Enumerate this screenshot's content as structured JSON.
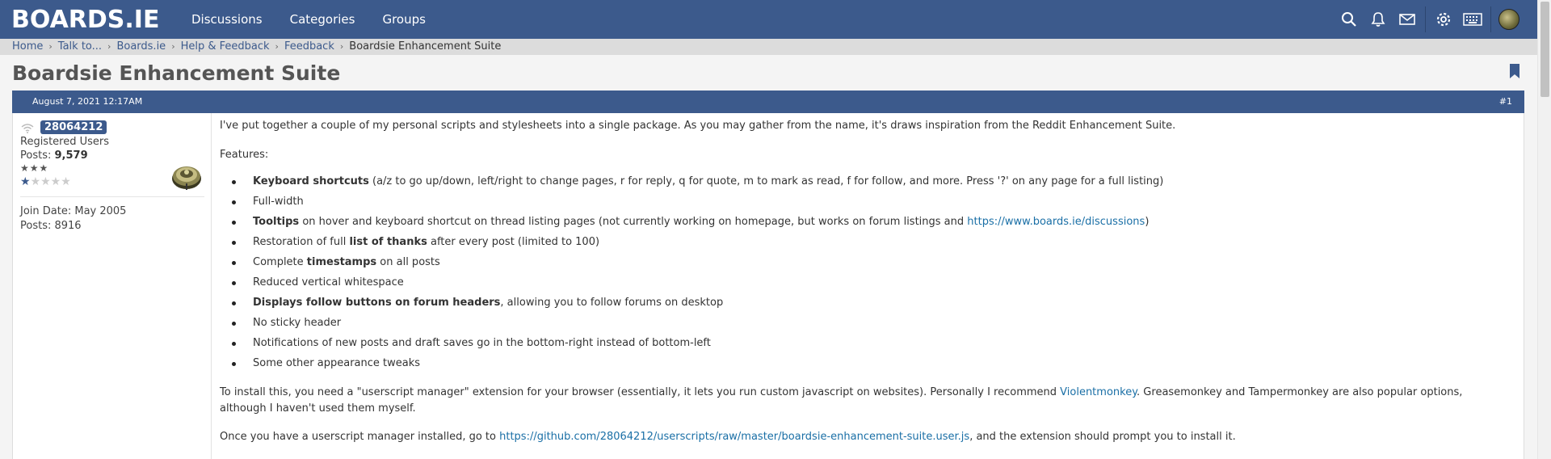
{
  "brand": {
    "logo_text": "BOARDS.IE"
  },
  "nav": {
    "links": [
      "Discussions",
      "Categories",
      "Groups"
    ]
  },
  "breadcrumb": [
    "Home",
    "Talk to...",
    "Boards.ie",
    "Help & Feedback",
    "Feedback"
  ],
  "breadcrumb_current": "Boardsie Enhancement Suite",
  "thread_title": "Boardsie Enhancement Suite",
  "post": {
    "date": "August 7, 2021 12:17AM",
    "number": "#1",
    "user": {
      "name": "28064212",
      "role": "Registered Users",
      "posts_label": "Posts:",
      "posts_value": "9,579",
      "stars_text": "★★★",
      "rating_on": 1,
      "rating_total": 5,
      "join_date": "Join Date: May 2005",
      "total_posts": "Posts: 8916"
    },
    "intro": "I've put together a couple of my personal scripts and stylesheets into a single package. As you may gather from the name, it's draws inspiration from the Reddit Enhancement Suite.",
    "features_label": "Features:",
    "features": {
      "f1_bold": "Keyboard shortcuts",
      "f1_rest": " (a/z to go up/down, left/right to change pages, r for reply, q for quote, m to mark as read, f for follow, and more. Press '?' on any page for a full listing)",
      "f2": "Full-width",
      "f3_bold": "Tooltips",
      "f3_rest": " on hover and keyboard shortcut on thread listing pages (not currently working on homepage, but works on forum listings and ",
      "f3_link": "https://www.boards.ie/discussions",
      "f3_end": ")",
      "f4_pre": "Restoration of full ",
      "f4_bold": "list of thanks",
      "f4_rest": " after every post (limited to 100)",
      "f5_pre": "Complete ",
      "f5_bold": "timestamps",
      "f5_rest": " on all posts",
      "f6": "Reduced vertical whitespace",
      "f7_bold": "Displays follow buttons on forum headers",
      "f7_rest": ", allowing you to follow forums on desktop",
      "f8": "No sticky header",
      "f9": "Notifications of new posts and draft saves go in the bottom-right instead of bottom-left",
      "f10": "Some other appearance tweaks"
    },
    "install_1_pre": "To install this, you need a \"userscript manager\" extension for your browser (essentially, it lets you run custom javascript on websites). Personally I recommend ",
    "install_1_link": "Violentmonkey",
    "install_1_post": ". Greasemonkey and Tampermonkey are also popular options,",
    "install_1_line2": "although I haven't used them myself.",
    "install_2_pre": "Once you have a userscript manager installed, go to ",
    "install_2_link": "https://github.com/28064212/userscripts/raw/master/boardsie-enhancement-suite.user.js",
    "install_2_post": ", and the extension should prompt you to install it."
  },
  "icons": [
    "search-icon",
    "bell-icon",
    "mail-icon",
    "gear-icon",
    "keyboard-icon",
    "user-avatar-icon",
    "bookmark-icon",
    "wifi-icon"
  ],
  "colors": {
    "header": "#3c5a8c",
    "link": "#1a6fa6",
    "background": "#f4f4f4"
  }
}
